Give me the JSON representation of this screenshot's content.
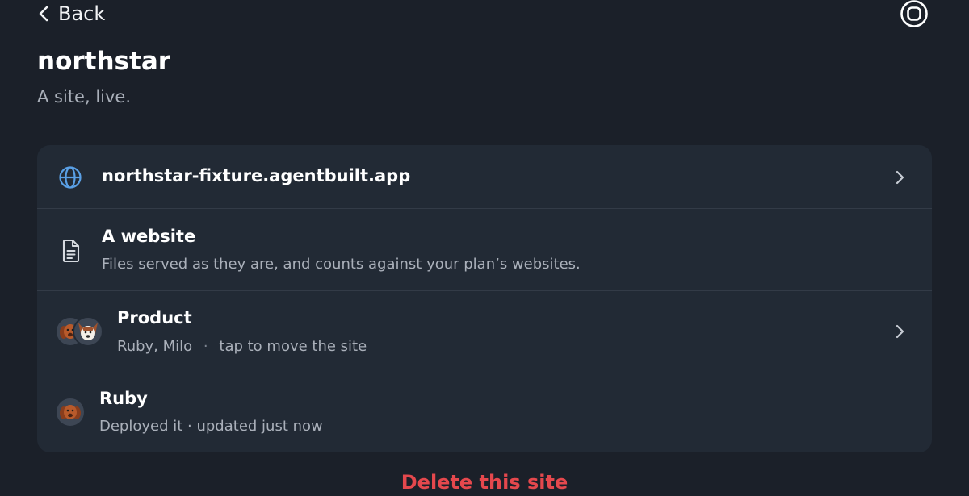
{
  "header": {
    "back_label": "Back",
    "title": "northstar",
    "subtitle": "A site, live."
  },
  "rows": [
    {
      "icon": "globe-icon",
      "title": "northstar-fixture.agentbuilt.app",
      "has_chevron": true
    },
    {
      "icon": "document-icon",
      "title": "A website",
      "subtitle": "Files served as they are, and counts against your plan’s websites."
    },
    {
      "icon": "team-avatars",
      "title": "Product",
      "members": "Ruby, Milo",
      "separator": "·",
      "hint": "tap to move the site",
      "has_chevron": true
    },
    {
      "icon": "ruby-avatar",
      "title": "Ruby",
      "subtitle": "Deployed it · updated just now"
    }
  ],
  "delete_label": "Delete this site",
  "colors": {
    "background": "#1b2029",
    "card": "#222a35",
    "accent_blue": "#5aa0e6",
    "danger": "#e5484d",
    "muted_text": "#aab0ba"
  }
}
